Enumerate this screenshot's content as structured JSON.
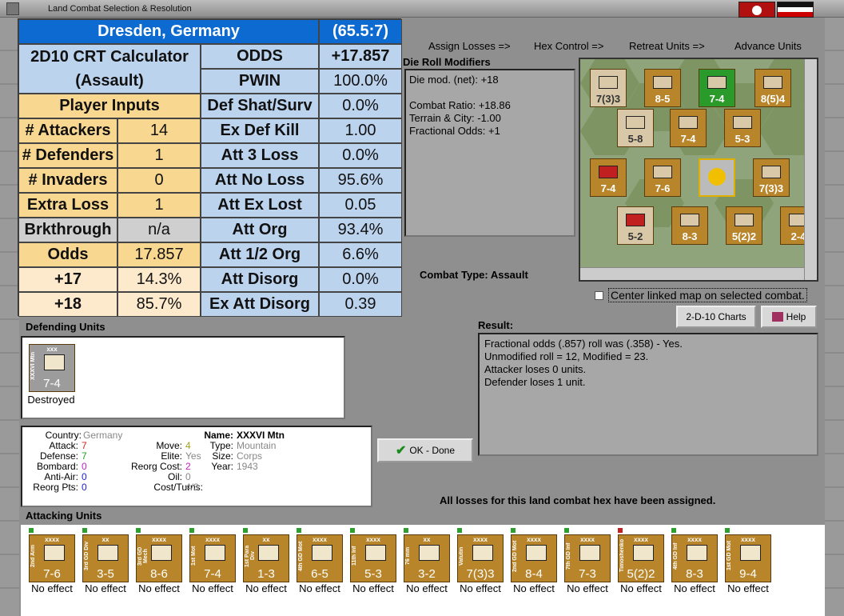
{
  "window": {
    "title": "Land Combat Selection & Resolution"
  },
  "crt": {
    "location": "Dresden, Germany",
    "coords": "(65.5:7)",
    "calc_title1": "2D10 CRT Calculator",
    "calc_title2": "(Assault)",
    "player_inputs": "Player Inputs",
    "odds_label": "ODDS",
    "odds_value": "+17.857",
    "pwin_label": "PWIN",
    "pwin_value": "100.0%",
    "rows": [
      {
        "k": "Def Shat/Surv",
        "v": "0.0%"
      },
      {
        "k": "Ex Def Kill",
        "v": "1.00"
      },
      {
        "k": "Att 3 Loss",
        "v": "0.0%"
      },
      {
        "k": "Att No Loss",
        "v": "95.6%"
      },
      {
        "k": "Att Ex Lost",
        "v": "0.05"
      },
      {
        "k": "Att Org",
        "v": "93.4%"
      },
      {
        "k": "Att 1/2 Org",
        "v": "6.6%"
      },
      {
        "k": "Att Disorg",
        "v": "0.0%"
      },
      {
        "k": "Ex Att Disorg",
        "v": "0.39"
      }
    ],
    "inputs": [
      {
        "k": "# Attackers",
        "v": "14"
      },
      {
        "k": "# Defenders",
        "v": "1"
      },
      {
        "k": "# Invaders",
        "v": "0"
      },
      {
        "k": "Extra Loss",
        "v": "1"
      },
      {
        "k": "Brkthrough",
        "v": "n/a"
      },
      {
        "k": "Odds",
        "v": "17.857"
      },
      {
        "k": "+17",
        "v": "14.3%"
      },
      {
        "k": "+18",
        "v": "85.7%"
      }
    ]
  },
  "steps": [
    "Assign Losses =>",
    "Hex Control =>",
    "Retreat Units =>",
    "Advance Units"
  ],
  "drm": {
    "title": "Die Roll Modifiers",
    "lines": [
      "Die mod. (net): +18",
      "",
      "Combat Ratio: +18.86",
      "Terrain & City: -1.00",
      "Fractional Odds: +1"
    ]
  },
  "combat_type": "Combat Type:  Assault",
  "center_linked": "Center linked map on selected combat.",
  "buttons": {
    "charts": "2-D-10 Charts",
    "help": "Help",
    "ok": "OK - Done"
  },
  "result": {
    "title": "Result:",
    "lines": [
      "Fractional odds (.857) roll was (.358)  - Yes.",
      "Unmodified roll = 12, Modified = 23.",
      "Attacker loses 0 units.",
      "Defender loses 1 unit."
    ]
  },
  "all_assigned": "All losses for this land combat hex have been assigned.",
  "defending": {
    "title": "Defending Units",
    "unit": {
      "size": "xxx",
      "label": "XXXVI Mtn",
      "value": "7-4",
      "status": "Destroyed"
    }
  },
  "info": {
    "country_k": "Country:",
    "country": "Germany",
    "attack_k": "Attack:",
    "attack": "7",
    "defense_k": "Defense:",
    "defense": "7",
    "bombard_k": "Bombard:",
    "bombard": "0",
    "antiair_k": "Anti-Air:",
    "antiair": "0",
    "reorgpts_k": "Reorg Pts:",
    "reorgpts": "0",
    "move_k": "Move:",
    "move": "4",
    "elite_k": "Elite:",
    "elite": "Yes",
    "reorgcost_k": "Reorg Cost:",
    "reorgcost": "2",
    "oil_k": "Oil:",
    "oil": "0",
    "costturns_k": "Cost/Turns:",
    "costturns": "4/3",
    "name_k": "Name:",
    "name": "XXXVI Mtn",
    "type_k": "Type:",
    "type": "Mountain",
    "size_k": "Size:",
    "size": "Corps",
    "year_k": "Year:",
    "year": "1943"
  },
  "attacking": {
    "title": "Attacking Units",
    "units": [
      {
        "size": "xxxx",
        "label": "2nd Arm",
        "value": "7-6",
        "status": "No effect"
      },
      {
        "size": "xx",
        "label": "3rd GD Div",
        "value": "3-5",
        "status": "No effect"
      },
      {
        "size": "xxxx",
        "label": "3rd GD Mech",
        "value": "8-6",
        "status": "No effect"
      },
      {
        "size": "xxxx",
        "label": "1st Mot",
        "value": "7-4",
        "status": "No effect"
      },
      {
        "size": "xx",
        "label": "1st Para Div",
        "value": "1-3",
        "status": "No effect"
      },
      {
        "size": "xxxx",
        "label": "4th GD Mot",
        "value": "6-5",
        "status": "No effect"
      },
      {
        "size": "xxxx",
        "label": "11th Inf",
        "value": "5-3",
        "status": "No effect"
      },
      {
        "size": "xx",
        "label": "76 mm",
        "value": "3-2",
        "status": "No effect"
      },
      {
        "size": "xxxx",
        "label": "Vatutin",
        "value": "7(3)3",
        "status": "No effect"
      },
      {
        "size": "xxxx",
        "label": "2nd GD Mot",
        "value": "8-4",
        "status": "No effect"
      },
      {
        "size": "xxxx",
        "label": "7th GD Inf",
        "value": "7-3",
        "status": "No effect"
      },
      {
        "size": "xxxx",
        "label": "Timoshenko",
        "value": "5(2)2",
        "status": "No effect"
      },
      {
        "size": "xxxx",
        "label": "4th GD Inf",
        "value": "8-3",
        "status": "No effect"
      },
      {
        "size": "xxxx",
        "label": "1st GD Mot",
        "value": "9-4",
        "status": "No effect"
      }
    ]
  },
  "map_counters": [
    {
      "v": "7(3)3"
    },
    {
      "v": "8-5"
    },
    {
      "v": "7-4"
    },
    {
      "v": "8(5)4"
    },
    {
      "v": "5-8"
    },
    {
      "v": "7-4"
    },
    {
      "v": "5-3"
    },
    {
      "v": "7-4"
    },
    {
      "v": "7-6"
    },
    {
      "v": "7(3)3"
    },
    {
      "v": "5-2"
    },
    {
      "v": "8-3"
    },
    {
      "v": "5(2)2"
    },
    {
      "v": "2-4"
    }
  ],
  "colors": {
    "header_blue": "#0c6ad1",
    "counter_brown": "#b8852a",
    "panel_grey": "#8f8f8f"
  }
}
